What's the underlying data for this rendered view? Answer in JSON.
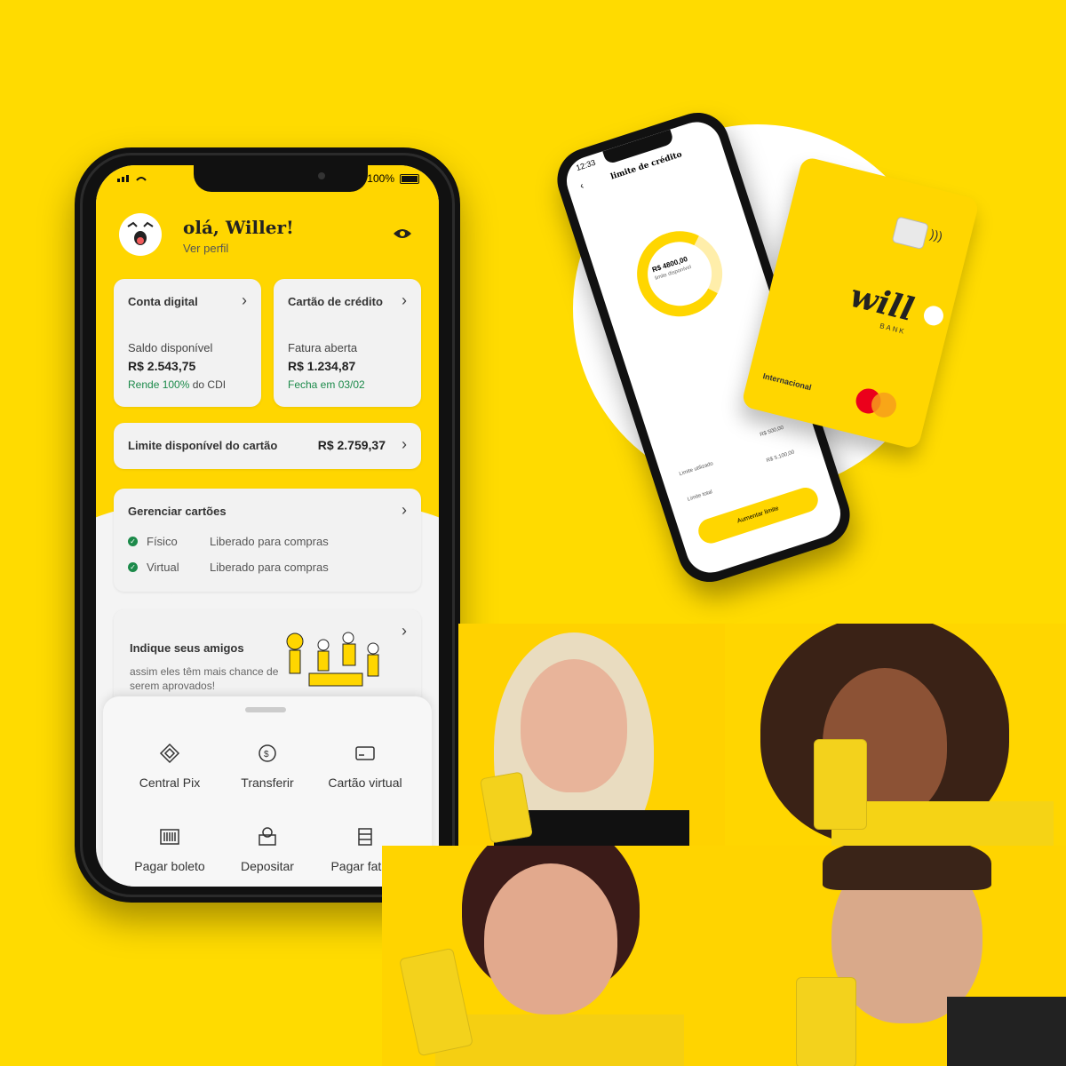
{
  "phone": {
    "status": {
      "battery": "100%"
    },
    "greeting": "olá, Willer!",
    "profile_link": "Ver perfil",
    "account_card": {
      "title": "Conta digital",
      "label": "Saldo disponível",
      "value": "R$ 2.543,75",
      "note_green": "Rende 100%",
      "note_rest": " do CDI"
    },
    "credit_card": {
      "title": "Cartão de crédito",
      "label": "Fatura aberta",
      "value": "R$ 1.234,87",
      "note_green": "Fecha em 03/02"
    },
    "limit": {
      "label": "Limite disponível do cartão",
      "value": "R$ 2.759,37"
    },
    "manage_cards": {
      "title": "Gerenciar cartões",
      "rows": [
        {
          "type": "Físico",
          "status": "Liberado para compras"
        },
        {
          "type": "Virtual",
          "status": "Liberado para compras"
        }
      ]
    },
    "refer": {
      "title": "Indique seus amigos",
      "desc": "assim eles têm mais chance de serem aprovados!"
    },
    "actions": [
      "Central Pix",
      "Transferir",
      "Cartão virtual",
      "Pagar boleto",
      "Depositar",
      "Pagar fatura"
    ]
  },
  "phone2": {
    "time": "12:33",
    "title": "limite de crédito",
    "ring_amount": "R$ 4800,00",
    "ring_label": "limite disponível",
    "used_label": "Limite utilizado",
    "used_value": "R$ 500,00",
    "total_label": "Limite total",
    "total_value": "R$ 5.100,00",
    "button": "Aumentar limite"
  },
  "credit_card_visual": {
    "brand": "will",
    "sub": "BANK",
    "tier": "Internacional"
  },
  "colors": {
    "brand_yellow": "#FFDB00",
    "green": "#1c8a4a"
  }
}
